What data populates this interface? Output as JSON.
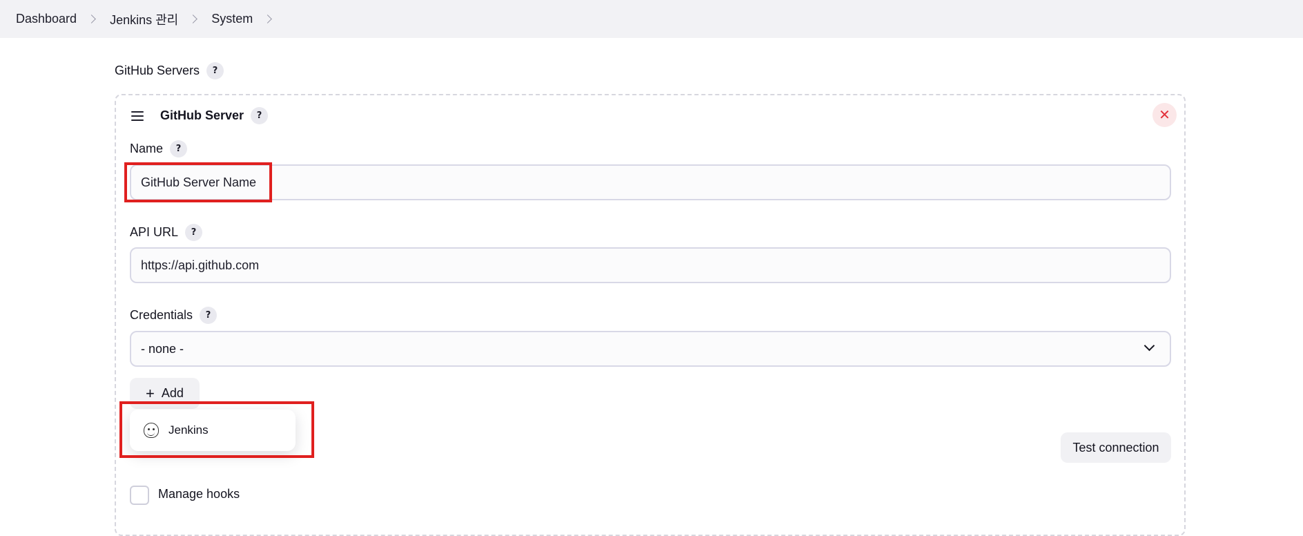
{
  "breadcrumb": {
    "items": [
      "Dashboard",
      "Jenkins 관리",
      "System"
    ]
  },
  "section": {
    "title": "GitHub Servers",
    "help": "?"
  },
  "server": {
    "title": "GitHub Server",
    "help": "?",
    "close": "✕",
    "name": {
      "label": "Name",
      "help": "?",
      "value": "GitHub Server Name"
    },
    "api_url": {
      "label": "API URL",
      "help": "?",
      "value": "https://api.github.com"
    },
    "credentials": {
      "label": "Credentials",
      "help": "?",
      "selected": "- none -"
    },
    "add_button": {
      "plus": "+",
      "label": "Add"
    },
    "add_menu": {
      "items": [
        {
          "icon": "jenkins-icon",
          "label": "Jenkins"
        }
      ]
    },
    "test_button": "Test connection",
    "manage_hooks": {
      "label": "Manage hooks",
      "checked": false
    }
  },
  "colors": {
    "highlight": "#e0201f",
    "close_icon": "#e2303a"
  }
}
